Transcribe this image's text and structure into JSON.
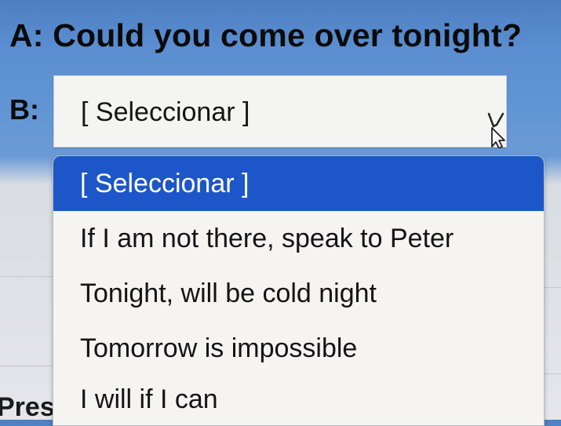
{
  "question": {
    "text": "A: Could you come over tonight?"
  },
  "answer": {
    "label": "B:",
    "selected_value": "[ Seleccionar ]"
  },
  "dropdown": {
    "options": [
      "[ Seleccionar ]",
      "If I am not there, speak to Peter",
      "Tonight, will be cold night",
      "Tomorrow is impossible",
      "I will if I can"
    ],
    "highlighted_index": 0
  },
  "background_partial_text": "Pres",
  "colors": {
    "page_top": "#4e7fc2",
    "highlight": "#1d56c8",
    "dropdown_bg": "#f5f4f1"
  },
  "icons": {
    "pointer": "mouse-pointer-icon"
  }
}
